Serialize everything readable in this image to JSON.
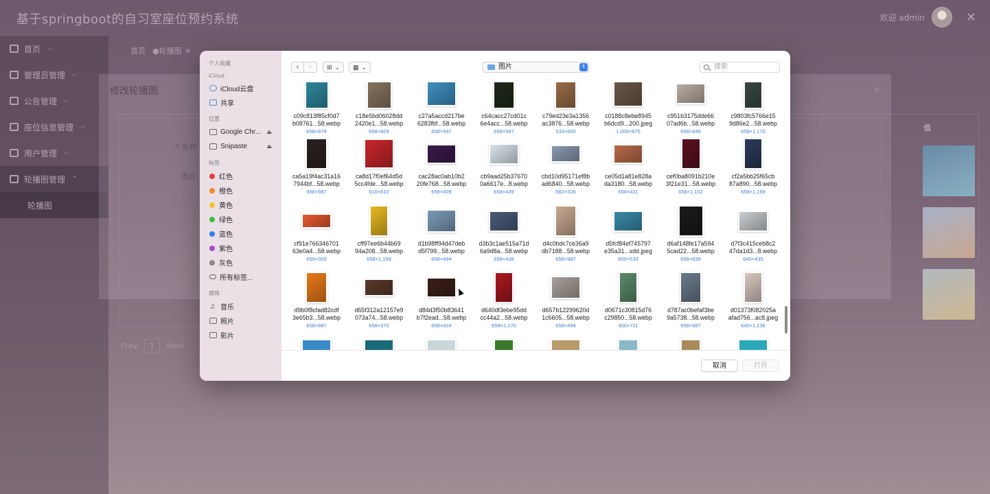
{
  "app": {
    "title": "基于springboot的自习室座位预约系统",
    "welcome": "欢迎 admin"
  },
  "sidebar": {
    "items": [
      {
        "label": "首页"
      },
      {
        "label": "管理员管理"
      },
      {
        "label": "公告管理"
      },
      {
        "label": "座位信息管理"
      },
      {
        "label": "用户管理"
      },
      {
        "label": "轮播图管理"
      },
      {
        "label": "轮播图"
      }
    ]
  },
  "breadcrumb": {
    "home": "首页",
    "current": "●轮播图"
  },
  "edit_dialog": {
    "title": "修改轮播图",
    "name_label": "* 名称",
    "image_label": "图片"
  },
  "table": {
    "col_value": "值"
  },
  "pager": {
    "prev": "Prev",
    "page": "1",
    "next": "Next"
  },
  "picker": {
    "sections": [
      {
        "title": "个人收藏",
        "items": []
      },
      {
        "title": "iCloud",
        "items": [
          "iCloud云盘",
          "共享"
        ]
      },
      {
        "title": "位置",
        "items": [
          "Google Chr...",
          "Snipaste"
        ]
      },
      {
        "title": "标签",
        "items": [
          "红色",
          "橙色",
          "黄色",
          "绿色",
          "蓝色",
          "紫色",
          "灰色",
          "所有标签..."
        ]
      },
      {
        "title": "媒体",
        "items": [
          "音乐",
          "照片",
          "影片"
        ]
      }
    ],
    "tag_colors": [
      "#e8403a",
      "#f08a26",
      "#f5c32c",
      "#3cbf3e",
      "#2f7ff0",
      "#a24ad6",
      "#8a8a8a"
    ],
    "location": "图片",
    "search_placeholder": "搜索",
    "cancel": "取消",
    "open": "打开",
    "files": [
      {
        "line1": "c09c813f85cf0d7",
        "line2": "b08761...58.webp",
        "dims": "658×879",
        "color": "#2e8aa0"
      },
      {
        "line1": "c18e5bd06028dd",
        "line2": "2420e1...58.webp",
        "dims": "658×829",
        "color": "#8a7560"
      },
      {
        "line1": "c27a5accd217be",
        "line2": "6283fbf...58.webp",
        "dims": "658×547",
        "color": "#3f8fc0"
      },
      {
        "line1": "c64cacc27cd01c",
        "line2": "6e4acc...58.webp",
        "dims": "658×987",
        "color": "#1f2a1a"
      },
      {
        "line1": "c79ed23e3a1356",
        "line2": "ac3876...58.webp",
        "dims": "533×800",
        "color": "#9a6e48"
      },
      {
        "line1": "c0188c8ebe8945",
        "line2": "b6dcd9...200.jpeg",
        "dims": "1,000×875",
        "color": "#6a5848"
      },
      {
        "line1": "c951b3175dde66",
        "line2": "07ad6b...58.webp",
        "dims": "658×439",
        "color": "#b8aca2"
      },
      {
        "line1": "c9803fc5766e15",
        "line2": "9d86e2...58.webp",
        "dims": "658×1,170",
        "color": "#3a4a44"
      },
      {
        "line1": "ca5a19f4ac31a16",
        "line2": "7944bf...58.webp",
        "dims": "658×987",
        "color": "#2a2220"
      },
      {
        "line1": "ca8d17f0ef64d5d",
        "line2": "5cc4fde...58.webp",
        "dims": "610×610",
        "color": "#c8262a"
      },
      {
        "line1": "cac28ac0ab10b2",
        "line2": "20fe768...58.webp",
        "dims": "658×409",
        "color": "#3a1a4a"
      },
      {
        "line1": "cb9aad25b37670",
        "line2": "0a6617e...8.webp",
        "dims": "658×439",
        "color": "#d8e4ea"
      },
      {
        "line1": "cbd10d95171ef8b",
        "line2": "ad6840...58.webp",
        "dims": "582×326",
        "color": "#8a9ab0"
      },
      {
        "line1": "ce05d1a81e828a",
        "line2": "da3180...58.webp",
        "dims": "658×411",
        "color": "#b86a48"
      },
      {
        "line1": "cef0ba8091b210e",
        "line2": "3f21e31...58.webp",
        "dims": "658×1,102",
        "color": "#5a1020"
      },
      {
        "line1": "cf2a5bb25f65cb",
        "line2": "87a890...58.webp",
        "dims": "658×1,169",
        "color": "#2a3a5a"
      },
      {
        "line1": "cf91e766346701",
        "line2": "63e0a4...58.webp",
        "dims": "650×300",
        "color": "#e85a30"
      },
      {
        "line1": "cff97ee6b44b69",
        "line2": "94a208...58.webp",
        "dims": "658×1,169",
        "color": "#e8b820"
      },
      {
        "line1": "d1b98ff94d47deb",
        "line2": "d5f799...58.webp",
        "dims": "658×494",
        "color": "#7a9ab8"
      },
      {
        "line1": "d3b3c1ae515a71d",
        "line2": "6a9d8a...58.webp",
        "dims": "658×438",
        "color": "#4a5a7a"
      },
      {
        "line1": "d4c0bdc7ce36a9",
        "line2": "db7188...58.webp",
        "dims": "658×987",
        "color": "#c8a890"
      },
      {
        "line1": "d5fcf84ef745797",
        "line2": "e35a31...xdd.jpeg",
        "dims": "800×533",
        "color": "#3a8aa8"
      },
      {
        "line1": "d6af148fe17a594",
        "line2": "5cad22...58.webp",
        "dims": "658×839",
        "color": "#1a1a1a"
      },
      {
        "line1": "d7f3c415ceb8c2",
        "line2": "47da1d3...8.webp",
        "dims": "640×435",
        "color": "#c8ccd0"
      },
      {
        "line1": "d9b0f8cfad82cdf",
        "line2": "3e65b3...58.webp",
        "dims": "658×987",
        "color": "#e87a18"
      },
      {
        "line1": "d65f312a12157e9",
        "line2": "073a74...58.webp",
        "dims": "658×370",
        "color": "#5a3a2a"
      },
      {
        "line1": "d84d3f50b83641",
        "line2": "b7f2ead...58.webp",
        "dims": "658×424",
        "color": "#3a2018"
      },
      {
        "line1": "d640df3ebe95dd",
        "line2": "cc44a2...58.webp",
        "dims": "658×1,170",
        "color": "#a81820"
      },
      {
        "line1": "d657b12299620d",
        "line2": "1c6605...58.webp",
        "dims": "658×494",
        "color": "#a8a09a"
      },
      {
        "line1": "d0671c30815d76",
        "line2": "c29850...58.webp",
        "dims": "400×711",
        "color": "#5a8a6a"
      },
      {
        "line1": "d787ac0befaf3be",
        "line2": "9a5738...58.webp",
        "dims": "658×987",
        "color": "#6a7a8a"
      },
      {
        "line1": "d01373f082025a",
        "line2": "afad756...ac8.jpeg",
        "dims": "640×1,138",
        "color": "#d8c8c0"
      }
    ],
    "partial_colors": [
      "#3a8ac8",
      "#1a6a7a",
      "#c8d8d8",
      "#3a7a2a",
      "#b89a6a",
      "#8ab8c8",
      "#a88a5a",
      "#2aa8b8"
    ]
  }
}
